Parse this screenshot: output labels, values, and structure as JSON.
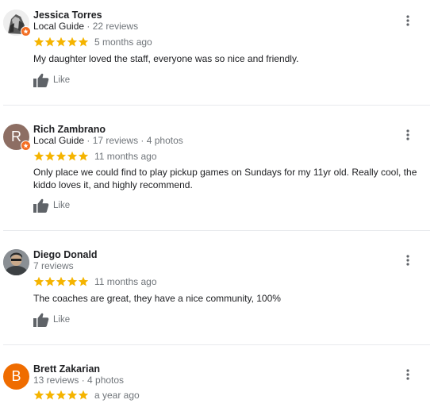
{
  "colors": {
    "star": "#f5b400",
    "guide_badge": "#f36e23",
    "muted": "#70757a"
  },
  "reviews": [
    {
      "name": "Jessica Torres",
      "guide": "Local Guide",
      "stats": "22 reviews",
      "rating": 5,
      "date": "5 months ago",
      "text": "My daughter loved the staff, everyone was so nice and friendly.",
      "like": "Like",
      "avatar_initial": "",
      "avatar_color": "#d8d8d8",
      "has_guide_badge": true
    },
    {
      "name": "Rich Zambrano",
      "guide": "Local Guide",
      "stats": "17 reviews · 4 photos",
      "rating": 5,
      "date": "11 months ago",
      "text": "Only place we could find to play pickup games on Sundays for my 11yr old. Really cool, the kiddo loves it, and highly recommend.",
      "like": "Like",
      "avatar_initial": "R",
      "avatar_color": "#8d6e63",
      "has_guide_badge": true
    },
    {
      "name": "Diego Donald",
      "guide": "",
      "stats": "7 reviews",
      "rating": 5,
      "date": "11 months ago",
      "text": "The coaches are great, they have a nice community, 100%",
      "like": "Like",
      "avatar_initial": "",
      "avatar_color": "#7a7e82",
      "has_guide_badge": false
    },
    {
      "name": "Brett Zakarian",
      "guide": "",
      "stats": "13 reviews · 4 photos",
      "rating": 5,
      "date": "a year ago",
      "text": "",
      "like": "",
      "avatar_initial": "B",
      "avatar_color": "#ef6c00",
      "has_guide_badge": false
    }
  ]
}
